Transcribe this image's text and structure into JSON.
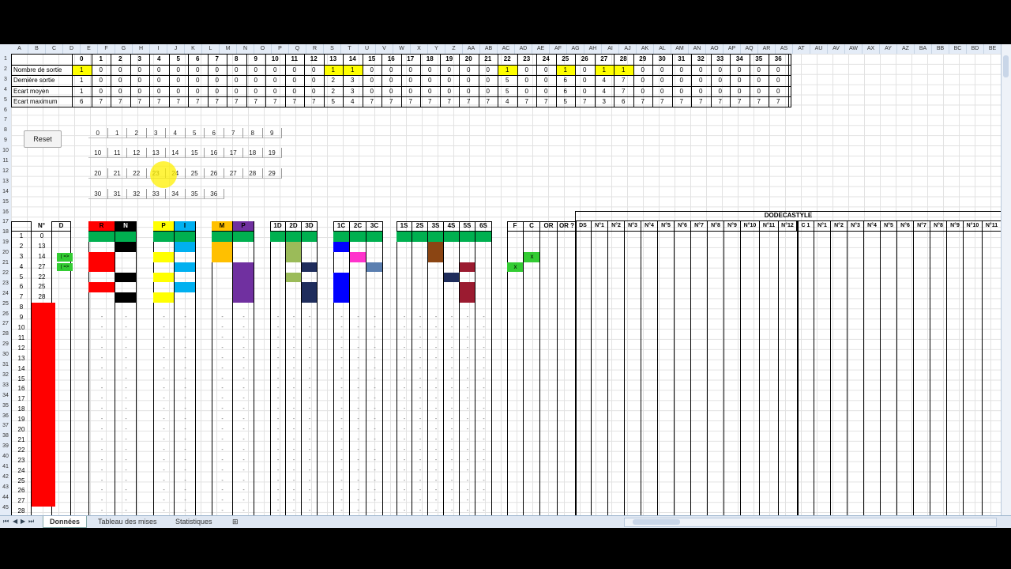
{
  "columns": [
    "A",
    "B",
    "C",
    "D",
    "E",
    "F",
    "G",
    "H",
    "I",
    "J",
    "K",
    "L",
    "M",
    "N",
    "O",
    "P",
    "Q",
    "R",
    "S",
    "T",
    "U",
    "V",
    "W",
    "X",
    "Y",
    "Z",
    "AA",
    "AB",
    "AC",
    "AD",
    "AE",
    "AF",
    "AG",
    "AH",
    "AI",
    "AJ",
    "AK",
    "AL",
    "AM",
    "AN",
    "AO",
    "AP",
    "AQ",
    "AR",
    "AS",
    "AT",
    "AU",
    "AV",
    "AW",
    "AX",
    "AY",
    "AZ",
    "BA",
    "BB",
    "BC",
    "BD",
    "BE"
  ],
  "rows": [
    "1",
    "2",
    "3",
    "4",
    "5",
    "6",
    "7",
    "8",
    "9",
    "10",
    "11",
    "12",
    "13",
    "14",
    "15",
    "16",
    "17",
    "18",
    "19",
    "20",
    "21",
    "22",
    "23",
    "24",
    "25",
    "26",
    "27",
    "28",
    "29",
    "30",
    "31",
    "32",
    "33",
    "34",
    "35",
    "36",
    "37",
    "38",
    "39",
    "40",
    "41",
    "42",
    "43",
    "44",
    "45"
  ],
  "stats": {
    "numbers": [
      "0",
      "1",
      "2",
      "3",
      "4",
      "5",
      "6",
      "7",
      "8",
      "9",
      "10",
      "11",
      "12",
      "13",
      "14",
      "15",
      "16",
      "17",
      "18",
      "19",
      "20",
      "21",
      "22",
      "23",
      "24",
      "25",
      "26",
      "27",
      "28",
      "29",
      "30",
      "31",
      "32",
      "33",
      "34",
      "35",
      "36"
    ],
    "labels": [
      "Nombre de sortie",
      "Dernière sortie",
      "Ecart moyen",
      "Ecart maximum"
    ],
    "nombre_sortie": [
      "1",
      "0",
      "0",
      "0",
      "0",
      "0",
      "0",
      "0",
      "0",
      "0",
      "0",
      "0",
      "0",
      "1",
      "1",
      "0",
      "0",
      "0",
      "0",
      "0",
      "0",
      "0",
      "1",
      "0",
      "0",
      "1",
      "0",
      "1",
      "1",
      "0",
      "0",
      "0",
      "0",
      "0",
      "0",
      "0",
      "0"
    ],
    "derniere_sortie": [
      "1",
      "0",
      "0",
      "0",
      "0",
      "0",
      "0",
      "0",
      "0",
      "0",
      "0",
      "0",
      "0",
      "2",
      "3",
      "0",
      "0",
      "0",
      "0",
      "0",
      "0",
      "0",
      "5",
      "0",
      "0",
      "6",
      "0",
      "4",
      "7",
      "0",
      "0",
      "0",
      "0",
      "0",
      "0",
      "0",
      "0"
    ],
    "ecart_moyen": [
      "1",
      "0",
      "0",
      "0",
      "0",
      "0",
      "0",
      "0",
      "0",
      "0",
      "0",
      "0",
      "0",
      "2",
      "3",
      "0",
      "0",
      "0",
      "0",
      "0",
      "0",
      "0",
      "5",
      "0",
      "0",
      "6",
      "0",
      "4",
      "7",
      "0",
      "0",
      "0",
      "0",
      "0",
      "0",
      "0",
      "0"
    ],
    "ecart_maximum": [
      "6",
      "7",
      "7",
      "7",
      "7",
      "7",
      "7",
      "7",
      "7",
      "7",
      "7",
      "7",
      "7",
      "5",
      "4",
      "7",
      "7",
      "7",
      "7",
      "7",
      "7",
      "7",
      "4",
      "7",
      "7",
      "5",
      "7",
      "3",
      "6",
      "7",
      "7",
      "7",
      "7",
      "7",
      "7",
      "7",
      "7"
    ],
    "highlight_color": "#ffff00"
  },
  "reset_label": "Reset",
  "picker_rows": [
    [
      "0",
      "1",
      "2",
      "3",
      "4",
      "5",
      "6",
      "7",
      "8",
      "9"
    ],
    [
      "10",
      "11",
      "12",
      "13",
      "14",
      "15",
      "16",
      "17",
      "18",
      "19"
    ],
    [
      "20",
      "21",
      "22",
      "23",
      "24",
      "25",
      "26",
      "27",
      "28",
      "29"
    ],
    [
      "30",
      "31",
      "32",
      "33",
      "34",
      "35",
      "36"
    ]
  ],
  "tracking": {
    "headers": [
      "N°",
      "D",
      "R",
      "N",
      "P",
      "I",
      "M",
      "P",
      "1D",
      "2D",
      "3D",
      "1C",
      "2C",
      "3C",
      "1S",
      "2S",
      "3S",
      "4S",
      "5S",
      "6S",
      "F",
      "C",
      "OR",
      "OR ?"
    ],
    "dodecastyle_title": "DODECASTYLE",
    "dodeca_headers_1": [
      "DS",
      "N°1",
      "N°2",
      "N°3",
      "N°4",
      "N°5",
      "N°6",
      "N°7",
      "N°8",
      "N°9",
      "N°10",
      "N°11",
      "N°12"
    ],
    "dodeca_headers_2": [
      "C 1",
      "N°1",
      "N°2",
      "N°3",
      "N°4",
      "N°5",
      "N°6",
      "N°7",
      "N°8",
      "N°9",
      "N°10",
      "N°11"
    ],
    "tirages": [
      "1",
      "2",
      "3",
      "4",
      "5",
      "6",
      "7",
      "8",
      "9",
      "10",
      "11",
      "12",
      "13",
      "14",
      "15",
      "16",
      "17",
      "18",
      "19",
      "20",
      "21",
      "22",
      "23",
      "24",
      "25",
      "26",
      "27",
      "28"
    ],
    "numeros": [
      "0",
      "13",
      "14",
      "27",
      "22",
      "25",
      "28"
    ],
    "arrow_text": "( =>",
    "x_mark": "x",
    "dash": "-"
  },
  "colors": {
    "red": "#ff0000",
    "black": "#000000",
    "yellow": "#ffff00",
    "blue": "#00b0f0",
    "orange": "#ffc000",
    "purple": "#7030a0",
    "green": "#00b050",
    "olive": "#9bbb59",
    "navy": "#1f2d5c",
    "blue2": "#0000ff",
    "magenta": "#ff33cc",
    "steel": "#5b7fb0",
    "brown": "#8b4513",
    "darkred": "#9b1b30",
    "lime": "#33cc33"
  },
  "tabs": [
    "Données",
    "Tableau des mises",
    "Statistiques"
  ]
}
